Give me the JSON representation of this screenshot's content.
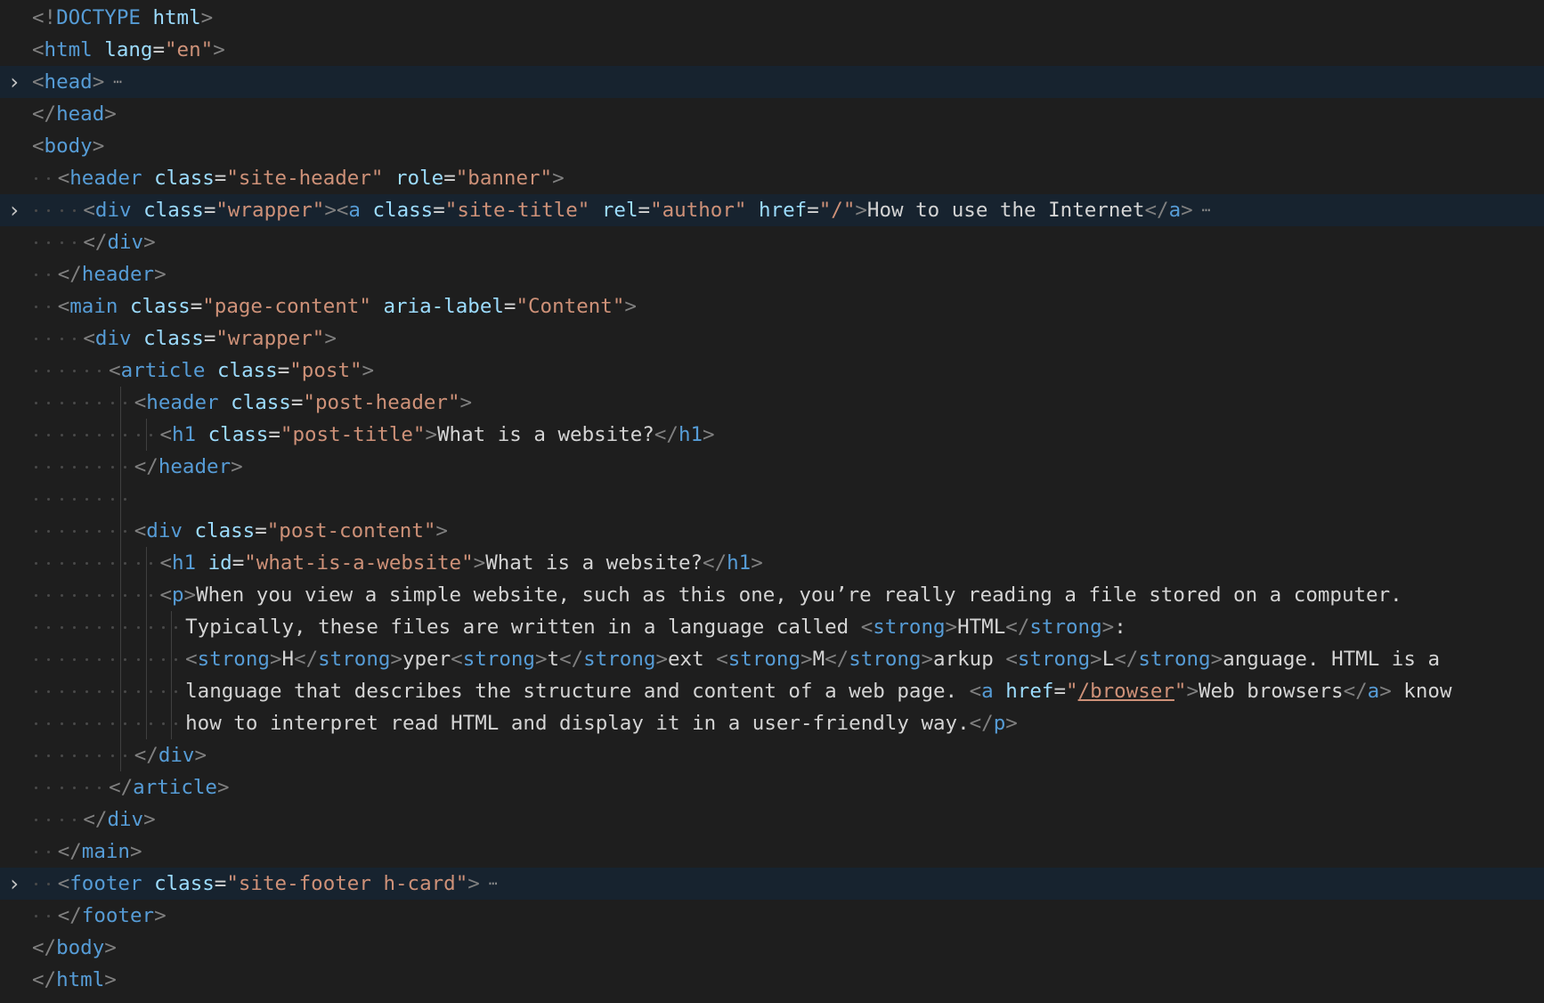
{
  "editor": {
    "language": "html",
    "fold_icon": "chevron-right-icon",
    "ellipsis_icon": "folded-ellipsis-icon",
    "colors": {
      "background": "#1e1e1e",
      "folded_line": "#17232f",
      "tag": "#569cd6",
      "bracket": "#808080",
      "attribute": "#9cdcfe",
      "string": "#ce9178",
      "text": "#d4d4d4"
    },
    "lines": [
      {
        "folded": false,
        "indent": 0,
        "tokens": [
          [
            "br",
            "<!"
          ],
          [
            "tag",
            "DOCTYPE"
          ],
          [
            "plain",
            " "
          ],
          [
            "attr",
            "html"
          ],
          [
            "br",
            ">"
          ]
        ]
      },
      {
        "folded": false,
        "indent": 0,
        "tokens": [
          [
            "br",
            "<"
          ],
          [
            "tag",
            "html"
          ],
          [
            "plain",
            " "
          ],
          [
            "attr",
            "lang"
          ],
          [
            "plain",
            "="
          ],
          [
            "str",
            "\"en\""
          ],
          [
            "br",
            ">"
          ]
        ]
      },
      {
        "folded": true,
        "indent": 0,
        "tokens": [
          [
            "br",
            "<"
          ],
          [
            "tag",
            "head"
          ],
          [
            "br",
            ">"
          ]
        ]
      },
      {
        "folded": false,
        "indent": 0,
        "tokens": [
          [
            "br",
            "</"
          ],
          [
            "tag",
            "head"
          ],
          [
            "br",
            ">"
          ]
        ]
      },
      {
        "folded": false,
        "indent": 0,
        "tokens": [
          [
            "br",
            "<"
          ],
          [
            "tag",
            "body"
          ],
          [
            "br",
            ">"
          ]
        ]
      },
      {
        "folded": false,
        "indent": 1,
        "tokens": [
          [
            "br",
            "<"
          ],
          [
            "tag",
            "header"
          ],
          [
            "plain",
            " "
          ],
          [
            "attr",
            "class"
          ],
          [
            "plain",
            "="
          ],
          [
            "str",
            "\"site-header\""
          ],
          [
            "plain",
            " "
          ],
          [
            "attr",
            "role"
          ],
          [
            "plain",
            "="
          ],
          [
            "str",
            "\"banner\""
          ],
          [
            "br",
            ">"
          ]
        ]
      },
      {
        "folded": true,
        "indent": 2,
        "tokens": [
          [
            "br",
            "<"
          ],
          [
            "tag",
            "div"
          ],
          [
            "plain",
            " "
          ],
          [
            "attr",
            "class"
          ],
          [
            "plain",
            "="
          ],
          [
            "str",
            "\"wrapper\""
          ],
          [
            "br",
            "><"
          ],
          [
            "tag",
            "a"
          ],
          [
            "plain",
            " "
          ],
          [
            "attr",
            "class"
          ],
          [
            "plain",
            "="
          ],
          [
            "str",
            "\"site-title\""
          ],
          [
            "plain",
            " "
          ],
          [
            "attr",
            "rel"
          ],
          [
            "plain",
            "="
          ],
          [
            "str",
            "\"author\""
          ],
          [
            "plain",
            " "
          ],
          [
            "attr",
            "href"
          ],
          [
            "plain",
            "="
          ],
          [
            "str",
            "\"/\""
          ],
          [
            "br",
            ">"
          ],
          [
            "plain",
            "How to use the Internet"
          ],
          [
            "br",
            "</"
          ],
          [
            "tag",
            "a"
          ],
          [
            "br",
            ">"
          ]
        ]
      },
      {
        "folded": false,
        "indent": 2,
        "tokens": [
          [
            "br",
            "</"
          ],
          [
            "tag",
            "div"
          ],
          [
            "br",
            ">"
          ]
        ]
      },
      {
        "folded": false,
        "indent": 1,
        "tokens": [
          [
            "br",
            "</"
          ],
          [
            "tag",
            "header"
          ],
          [
            "br",
            ">"
          ]
        ]
      },
      {
        "folded": false,
        "indent": 1,
        "tokens": [
          [
            "br",
            "<"
          ],
          [
            "tag",
            "main"
          ],
          [
            "plain",
            " "
          ],
          [
            "attr",
            "class"
          ],
          [
            "plain",
            "="
          ],
          [
            "str",
            "\"page-content\""
          ],
          [
            "plain",
            " "
          ],
          [
            "attr",
            "aria-label"
          ],
          [
            "plain",
            "="
          ],
          [
            "str",
            "\"Content\""
          ],
          [
            "br",
            ">"
          ]
        ]
      },
      {
        "folded": false,
        "indent": 2,
        "tokens": [
          [
            "br",
            "<"
          ],
          [
            "tag",
            "div"
          ],
          [
            "plain",
            " "
          ],
          [
            "attr",
            "class"
          ],
          [
            "plain",
            "="
          ],
          [
            "str",
            "\"wrapper\""
          ],
          [
            "br",
            ">"
          ]
        ]
      },
      {
        "folded": false,
        "indent": 3,
        "tokens": [
          [
            "br",
            "<"
          ],
          [
            "tag",
            "article"
          ],
          [
            "plain",
            " "
          ],
          [
            "attr",
            "class"
          ],
          [
            "plain",
            "="
          ],
          [
            "str",
            "\"post\""
          ],
          [
            "br",
            ">"
          ]
        ]
      },
      {
        "folded": false,
        "indent": 4,
        "bars": [
          3
        ],
        "tokens": [
          [
            "br",
            "<"
          ],
          [
            "tag",
            "header"
          ],
          [
            "plain",
            " "
          ],
          [
            "attr",
            "class"
          ],
          [
            "plain",
            "="
          ],
          [
            "str",
            "\"post-header\""
          ],
          [
            "br",
            ">"
          ]
        ]
      },
      {
        "folded": false,
        "indent": 5,
        "bars": [
          3,
          4
        ],
        "tokens": [
          [
            "br",
            "<"
          ],
          [
            "tag",
            "h1"
          ],
          [
            "plain",
            " "
          ],
          [
            "attr",
            "class"
          ],
          [
            "plain",
            "="
          ],
          [
            "str",
            "\"post-title\""
          ],
          [
            "br",
            ">"
          ],
          [
            "plain",
            "What is a website?"
          ],
          [
            "br",
            "</"
          ],
          [
            "tag",
            "h1"
          ],
          [
            "br",
            ">"
          ]
        ]
      },
      {
        "folded": false,
        "indent": 4,
        "bars": [
          3
        ],
        "tokens": [
          [
            "br",
            "</"
          ],
          [
            "tag",
            "header"
          ],
          [
            "br",
            ">"
          ]
        ]
      },
      {
        "folded": false,
        "indent": 4,
        "bars": [
          3
        ],
        "blank": true,
        "tokens": []
      },
      {
        "folded": false,
        "indent": 4,
        "bars": [
          3
        ],
        "tokens": [
          [
            "br",
            "<"
          ],
          [
            "tag",
            "div"
          ],
          [
            "plain",
            " "
          ],
          [
            "attr",
            "class"
          ],
          [
            "plain",
            "="
          ],
          [
            "str",
            "\"post-content\""
          ],
          [
            "br",
            ">"
          ]
        ]
      },
      {
        "folded": false,
        "indent": 5,
        "bars": [
          3,
          4
        ],
        "tokens": [
          [
            "br",
            "<"
          ],
          [
            "tag",
            "h1"
          ],
          [
            "plain",
            " "
          ],
          [
            "attr",
            "id"
          ],
          [
            "plain",
            "="
          ],
          [
            "str",
            "\"what-is-a-website\""
          ],
          [
            "br",
            ">"
          ],
          [
            "plain",
            "What is a website?"
          ],
          [
            "br",
            "</"
          ],
          [
            "tag",
            "h1"
          ],
          [
            "br",
            ">"
          ]
        ]
      },
      {
        "folded": false,
        "indent": 5,
        "bars": [
          3,
          4
        ],
        "tokens": [
          [
            "br",
            "<"
          ],
          [
            "tag",
            "p"
          ],
          [
            "br",
            ">"
          ],
          [
            "plain",
            "When you view a simple website, such as this one, you’re really reading a file stored on a computer."
          ]
        ]
      },
      {
        "folded": false,
        "indent": 6,
        "bars": [
          3,
          4,
          5
        ],
        "tokens": [
          [
            "plain",
            "Typically, these files are written in a language called "
          ],
          [
            "br",
            "<"
          ],
          [
            "tag",
            "strong"
          ],
          [
            "br",
            ">"
          ],
          [
            "plain",
            "HTML"
          ],
          [
            "br",
            "</"
          ],
          [
            "tag",
            "strong"
          ],
          [
            "br",
            ">"
          ],
          [
            "plain",
            ":"
          ]
        ]
      },
      {
        "folded": false,
        "indent": 6,
        "bars": [
          3,
          4,
          5
        ],
        "tokens": [
          [
            "br",
            "<"
          ],
          [
            "tag",
            "strong"
          ],
          [
            "br",
            ">"
          ],
          [
            "plain",
            "H"
          ],
          [
            "br",
            "</"
          ],
          [
            "tag",
            "strong"
          ],
          [
            "br",
            ">"
          ],
          [
            "plain",
            "yper"
          ],
          [
            "br",
            "<"
          ],
          [
            "tag",
            "strong"
          ],
          [
            "br",
            ">"
          ],
          [
            "plain",
            "t"
          ],
          [
            "br",
            "</"
          ],
          [
            "tag",
            "strong"
          ],
          [
            "br",
            ">"
          ],
          [
            "plain",
            "ext "
          ],
          [
            "br",
            "<"
          ],
          [
            "tag",
            "strong"
          ],
          [
            "br",
            ">"
          ],
          [
            "plain",
            "M"
          ],
          [
            "br",
            "</"
          ],
          [
            "tag",
            "strong"
          ],
          [
            "br",
            ">"
          ],
          [
            "plain",
            "arkup "
          ],
          [
            "br",
            "<"
          ],
          [
            "tag",
            "strong"
          ],
          [
            "br",
            ">"
          ],
          [
            "plain",
            "L"
          ],
          [
            "br",
            "</"
          ],
          [
            "tag",
            "strong"
          ],
          [
            "br",
            ">"
          ],
          [
            "plain",
            "anguage. HTML is a"
          ]
        ]
      },
      {
        "folded": false,
        "indent": 6,
        "bars": [
          3,
          4,
          5
        ],
        "tokens": [
          [
            "plain",
            "language that describes the structure and content of a web page. "
          ],
          [
            "br",
            "<"
          ],
          [
            "tag",
            "a"
          ],
          [
            "plain",
            " "
          ],
          [
            "attr",
            "href"
          ],
          [
            "plain",
            "="
          ],
          [
            "str",
            "\""
          ],
          [
            "link",
            "/browser"
          ],
          [
            "str",
            "\""
          ],
          [
            "br",
            ">"
          ],
          [
            "plain",
            "Web browsers"
          ],
          [
            "br",
            "</"
          ],
          [
            "tag",
            "a"
          ],
          [
            "br",
            ">"
          ],
          [
            "plain",
            " know"
          ]
        ]
      },
      {
        "folded": false,
        "indent": 6,
        "bars": [
          3,
          4,
          5
        ],
        "tokens": [
          [
            "plain",
            "how to interpret read HTML and display it in a user-friendly way."
          ],
          [
            "br",
            "</"
          ],
          [
            "tag",
            "p"
          ],
          [
            "br",
            ">"
          ]
        ]
      },
      {
        "folded": false,
        "indent": 4,
        "bars": [
          3
        ],
        "tokens": [
          [
            "br",
            "</"
          ],
          [
            "tag",
            "div"
          ],
          [
            "br",
            ">"
          ]
        ]
      },
      {
        "folded": false,
        "indent": 3,
        "tokens": [
          [
            "br",
            "</"
          ],
          [
            "tag",
            "article"
          ],
          [
            "br",
            ">"
          ]
        ]
      },
      {
        "folded": false,
        "indent": 2,
        "tokens": [
          [
            "br",
            "</"
          ],
          [
            "tag",
            "div"
          ],
          [
            "br",
            ">"
          ]
        ]
      },
      {
        "folded": false,
        "indent": 1,
        "tokens": [
          [
            "br",
            "</"
          ],
          [
            "tag",
            "main"
          ],
          [
            "br",
            ">"
          ]
        ]
      },
      {
        "folded": true,
        "indent": 1,
        "tokens": [
          [
            "br",
            "<"
          ],
          [
            "tag",
            "footer"
          ],
          [
            "plain",
            " "
          ],
          [
            "attr",
            "class"
          ],
          [
            "plain",
            "="
          ],
          [
            "str",
            "\"site-footer h-card\""
          ],
          [
            "br",
            ">"
          ]
        ]
      },
      {
        "folded": false,
        "indent": 1,
        "tokens": [
          [
            "br",
            "</"
          ],
          [
            "tag",
            "footer"
          ],
          [
            "br",
            ">"
          ]
        ]
      },
      {
        "folded": false,
        "indent": 0,
        "tokens": [
          [
            "br",
            "</"
          ],
          [
            "tag",
            "body"
          ],
          [
            "br",
            ">"
          ]
        ]
      },
      {
        "folded": false,
        "indent": 0,
        "tokens": [
          [
            "br",
            "</"
          ],
          [
            "tag",
            "html"
          ],
          [
            "br",
            ">"
          ]
        ]
      }
    ]
  }
}
